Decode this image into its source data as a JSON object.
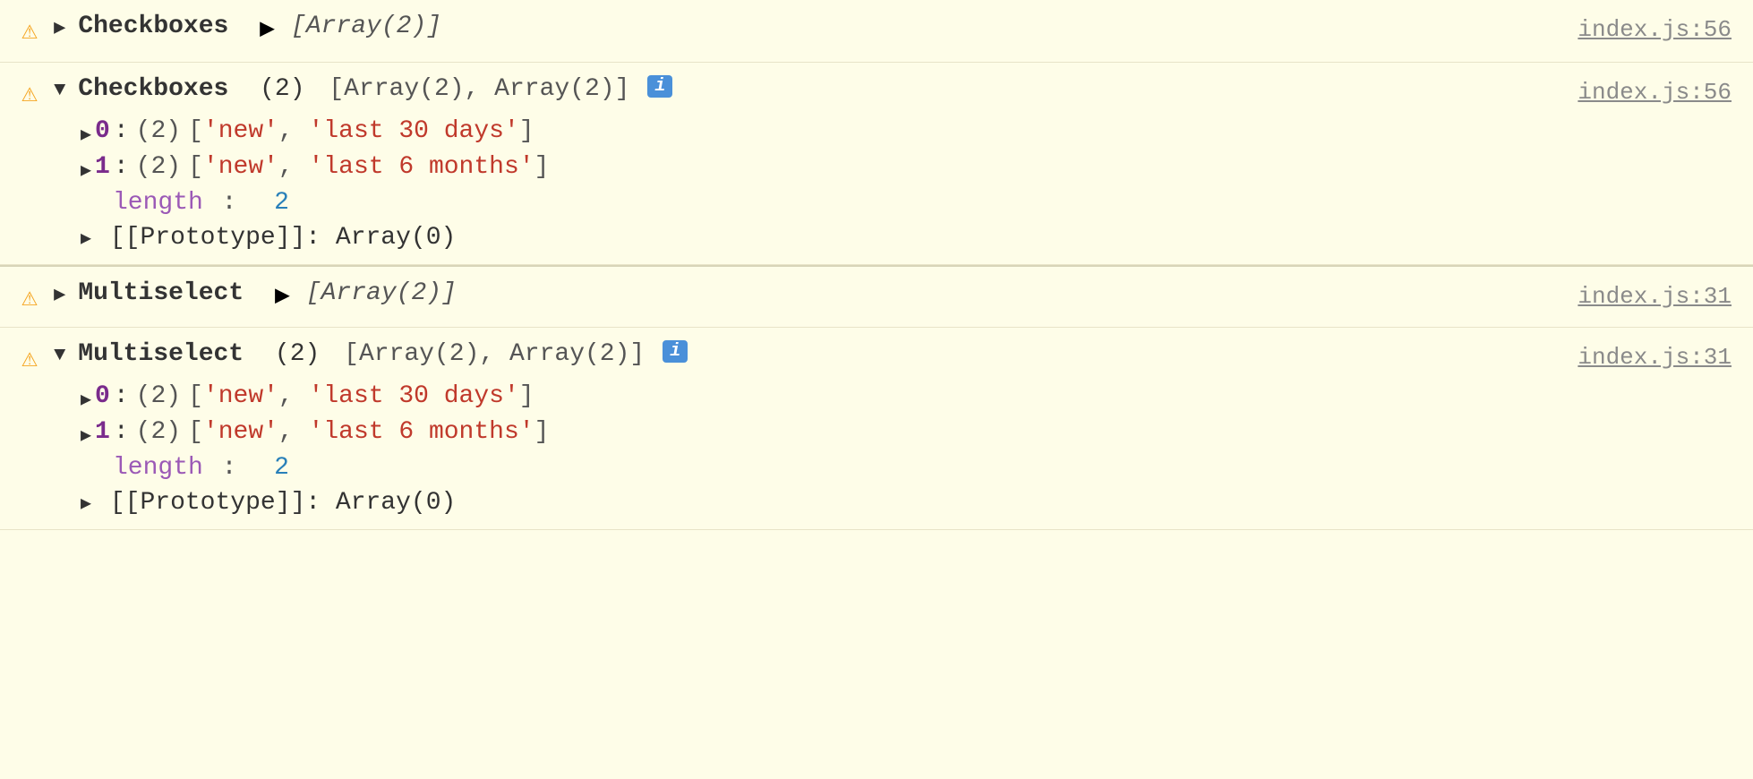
{
  "rows": [
    {
      "id": "row1",
      "type": "collapsed",
      "icon": "⚠",
      "label": "Checkboxes",
      "arrow": "▶",
      "arraySummary": "[Array(2)]",
      "fileRef": "index.js:56"
    },
    {
      "id": "row2",
      "type": "expanded",
      "icon": "⚠",
      "label": "Checkboxes",
      "arrow": "▼",
      "arrayCount": "(2)",
      "arrayContent": "[Array(2), Array(2)]",
      "hasInfoBadge": true,
      "fileRef": "index.js:56",
      "items": [
        {
          "index": "0",
          "count": "(2)",
          "values": [
            "'new'",
            "'last 30 days'"
          ]
        },
        {
          "index": "1",
          "count": "(2)",
          "values": [
            "'new'",
            "'last 6 months'"
          ]
        }
      ],
      "length": "2",
      "prototype": "[[Prototype]]: Array(0)"
    },
    {
      "id": "row3",
      "type": "collapsed",
      "icon": "⚠",
      "label": "Multiselect",
      "arrow": "▶",
      "arraySummary": "[Array(2)]",
      "fileRef": "index.js:31"
    },
    {
      "id": "row4",
      "type": "expanded",
      "icon": "⚠",
      "label": "Multiselect",
      "arrow": "▼",
      "arrayCount": "(2)",
      "arrayContent": "[Array(2), Array(2)]",
      "hasInfoBadge": true,
      "fileRef": "index.js:31",
      "items": [
        {
          "index": "0",
          "count": "(2)",
          "values": [
            "'new'",
            "'last 30 days'"
          ]
        },
        {
          "index": "1",
          "count": "(2)",
          "values": [
            "'new'",
            "'last 6 months'"
          ]
        }
      ],
      "length": "2",
      "prototype": "[[Prototype]]: Array(0)"
    }
  ],
  "colors": {
    "warning": "#f5a623",
    "string": "#c0392b",
    "index": "#7a2b8c",
    "length_key": "#9b59b6",
    "length_val": "#2980b9",
    "fileref": "#8a8a8a",
    "infobadge": "#4a90d9"
  }
}
